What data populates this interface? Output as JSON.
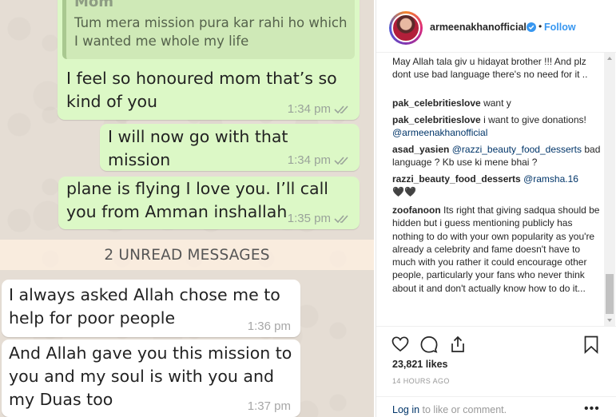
{
  "chat": {
    "reply_quote": {
      "author": "Mom",
      "text": "Tum mera mission pura kar rahi ho which I wanted me whole my life"
    },
    "messages": [
      {
        "direction": "outgoing",
        "text": "I feel so honoured mom that’s so kind of you",
        "time": "1:34 pm"
      },
      {
        "direction": "outgoing",
        "text": "I will now go with that mission",
        "time": "1:34 pm"
      },
      {
        "direction": "outgoing",
        "text": "plane is flying I love you. I’ll call you from Amman inshallah",
        "time": "1:35 pm"
      },
      {
        "direction": "incoming",
        "text": "I always asked Allah chose me to help for poor people",
        "time": "1:36 pm"
      },
      {
        "direction": "incoming",
        "text": "And Allah gave you this mission to you and my soul is with you and my Duas too",
        "time": "1:37 pm"
      }
    ],
    "unread_banner": "2 UNREAD MESSAGES",
    "colors": {
      "outgoing": "#dcf8c6",
      "incoming": "#ffffff",
      "read_ticks": "#9aa39a"
    }
  },
  "instagram": {
    "username": "armeenakhanofficial",
    "verified": true,
    "separator": "•",
    "follow_label": "Follow",
    "comments": [
      {
        "user": "",
        "text": "May Allah tala giv u hidayat brother !!! And plz dont use bad language there's no need for it ..",
        "mention": ""
      },
      {
        "user": "pak_celebritieslove",
        "text": "want y",
        "mention": ""
      },
      {
        "user": "pak_celebritieslove",
        "text": "i want to give donations!",
        "mention": "@armeenakhanofficial"
      },
      {
        "user": "asad_yasien",
        "text": "bad language ? Kb use ki mene bhai ?",
        "mention": "@razzi_beauty_food_desserts"
      },
      {
        "user": "razzi_beauty_food_desserts",
        "text": "🖤🖤",
        "mention": "@ramsha.16"
      },
      {
        "user": "zoofanoon",
        "text": "Its right that giving sadqua should be hidden but i guess mentioning publicly has nothing to do with your own popularity as you're already a celebrity and fame doesn't have to much with you rather it could encourage other people, particularly your fans who never think about it and don't actually know how to do it...",
        "mention": ""
      }
    ],
    "likes": "23,821 likes",
    "time_ago": "14 HOURS AGO",
    "login_link": "Log in",
    "login_rest": " to like or comment.",
    "more_glyph": "•••",
    "colors": {
      "link": "#3897f0",
      "verified": "#3897f0",
      "text": "#262626",
      "muted": "#999999"
    },
    "icons": [
      "heart-icon",
      "comment-icon",
      "share-icon",
      "bookmark-icon"
    ]
  }
}
